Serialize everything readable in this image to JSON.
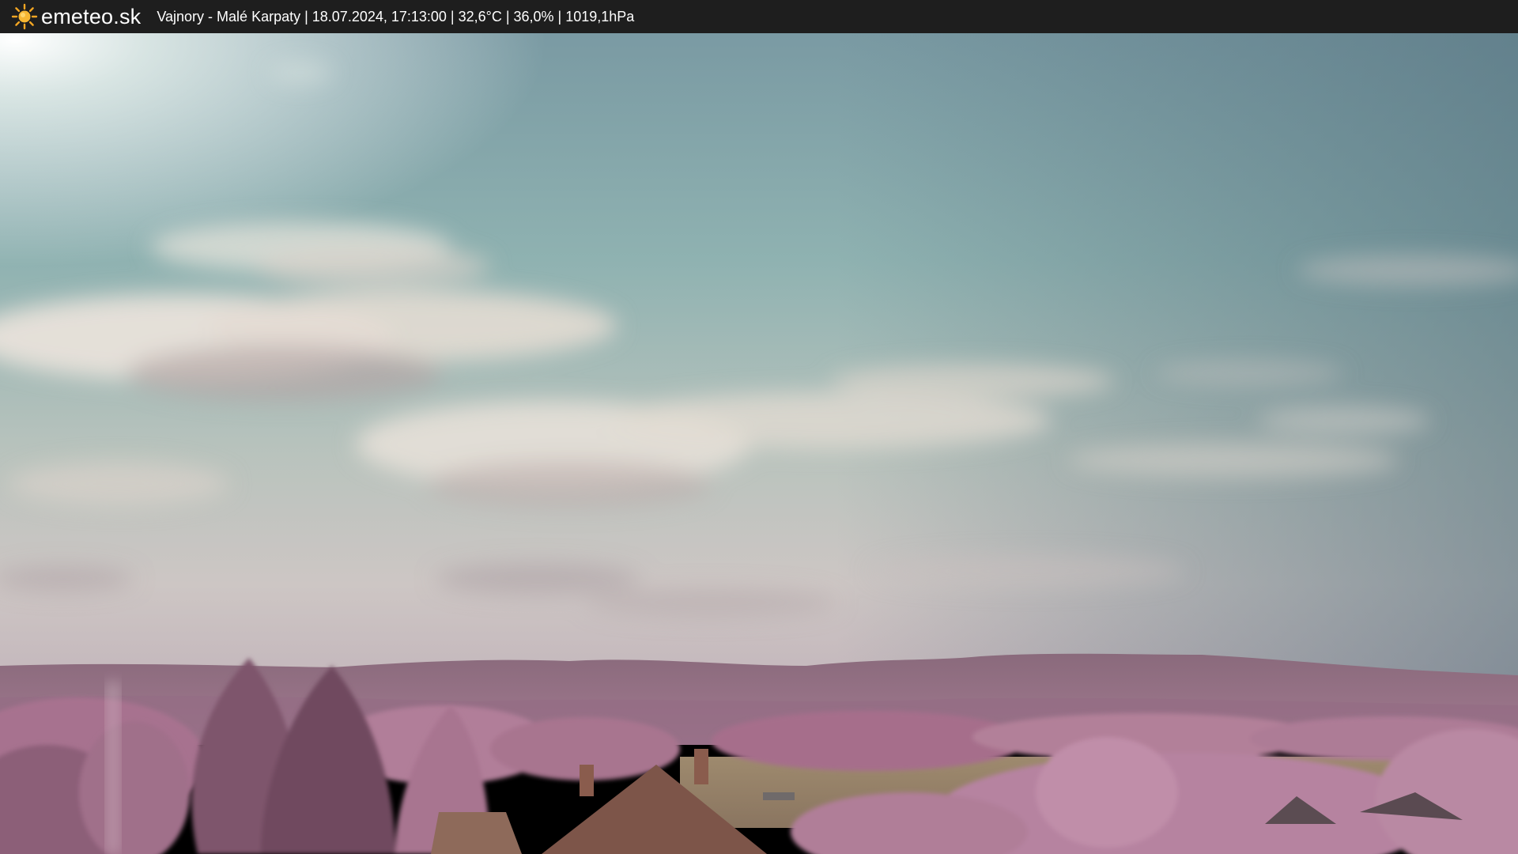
{
  "header": {
    "brand": "emeteo.sk",
    "info": "Vajnory - Malé Karpaty | 18.07.2024, 17:13:00 | 32,6°C | 36,0% | 1019,1hPa"
  },
  "colors": {
    "sky_top": "#5c7b87",
    "sky_mid": "#8fb0b0",
    "sky_horizon": "#c9c4c2",
    "cloud": "#e6e0d9",
    "hills": "#7a5a6c",
    "foliage": "#b07a98",
    "bar": "#1e1e1e"
  },
  "icons": {
    "logo": "sun-icon"
  }
}
